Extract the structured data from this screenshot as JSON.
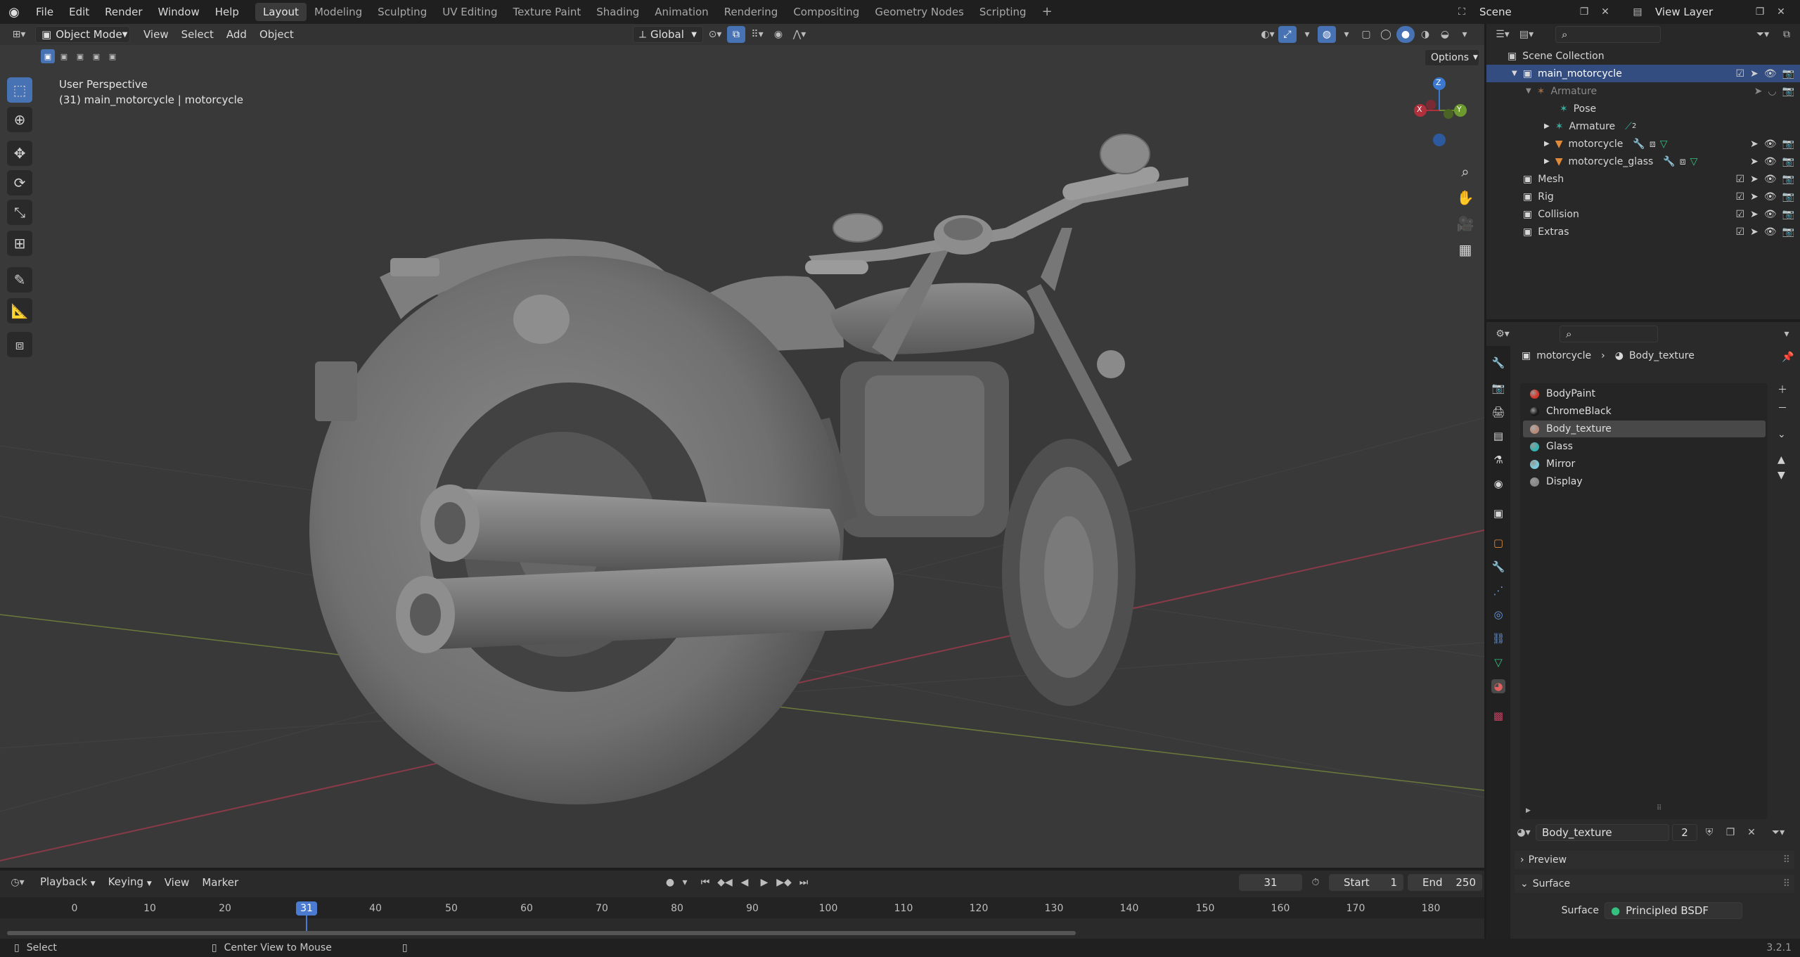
{
  "topbar": {
    "menus": [
      "File",
      "Edit",
      "Render",
      "Window",
      "Help"
    ],
    "workspaces": [
      "Layout",
      "Modeling",
      "Sculpting",
      "UV Editing",
      "Texture Paint",
      "Shading",
      "Animation",
      "Rendering",
      "Compositing",
      "Geometry Nodes",
      "Scripting"
    ],
    "active_workspace": "Layout",
    "add_tab": "+",
    "scene": "Scene",
    "view_layer": "View Layer"
  },
  "viewport": {
    "mode": "Object Mode",
    "menus": [
      "View",
      "Select",
      "Add",
      "Object"
    ],
    "transform_orientation": "Global",
    "options_label": "Options",
    "overlay_line1": "User Perspective",
    "overlay_line2": "(31) main_motorcycle | motorcycle",
    "gizmo_axes": {
      "x": "X",
      "y": "Y",
      "z": "Z"
    }
  },
  "outliner": {
    "items": [
      {
        "label": "Scene Collection",
        "level": 0
      },
      {
        "label": "main_motorcycle",
        "level": 1
      },
      {
        "label": "Armature",
        "level": 2
      },
      {
        "label": "Pose",
        "level": 3
      },
      {
        "label": "Armature",
        "level": 3
      },
      {
        "label": "motorcycle",
        "level": 3
      },
      {
        "label": "motorcycle_glass",
        "level": 3
      },
      {
        "label": "Mesh",
        "level": 1
      },
      {
        "label": "Rig",
        "level": 1
      },
      {
        "label": "Collision",
        "level": 1
      },
      {
        "label": "Extras",
        "level": 1
      }
    ],
    "armature_badge": "2"
  },
  "properties": {
    "breadcrumb_object": "motorcycle",
    "breadcrumb_material": "Body_texture",
    "material_slots": [
      {
        "name": "BodyPaint",
        "color": "#d33a2c"
      },
      {
        "name": "ChromeBlack",
        "color": "#1a1a1a"
      },
      {
        "name": "Body_texture",
        "color": "#b88a78"
      },
      {
        "name": "Glass",
        "color": "#37b3b0"
      },
      {
        "name": "Mirror",
        "color": "#7ac8d8"
      },
      {
        "name": "Display",
        "color": "#888888"
      }
    ],
    "selected_slot": "Body_texture",
    "material_name": "Body_texture",
    "user_count": "2",
    "panel_preview": "Preview",
    "panel_surface": "Surface",
    "surface_label": "Surface",
    "surface_value": "Principled BSDF"
  },
  "timeline": {
    "menus": [
      "Playback",
      "Keying",
      "View",
      "Marker"
    ],
    "current_frame": "31",
    "start_label": "Start",
    "start_value": "1",
    "end_label": "End",
    "end_value": "250",
    "ticks": [
      "0",
      "10",
      "20",
      "31",
      "40",
      "50",
      "60",
      "70",
      "80",
      "90",
      "100",
      "110",
      "120",
      "130",
      "140",
      "150",
      "160",
      "170",
      "180"
    ]
  },
  "statusbar": {
    "left": "Select",
    "middle": "Center View to Mouse",
    "version": "3.2.1"
  },
  "colors": {
    "accent": "#4772b3",
    "selection": "#334d80",
    "frame_marker": "#4a7bd0"
  }
}
